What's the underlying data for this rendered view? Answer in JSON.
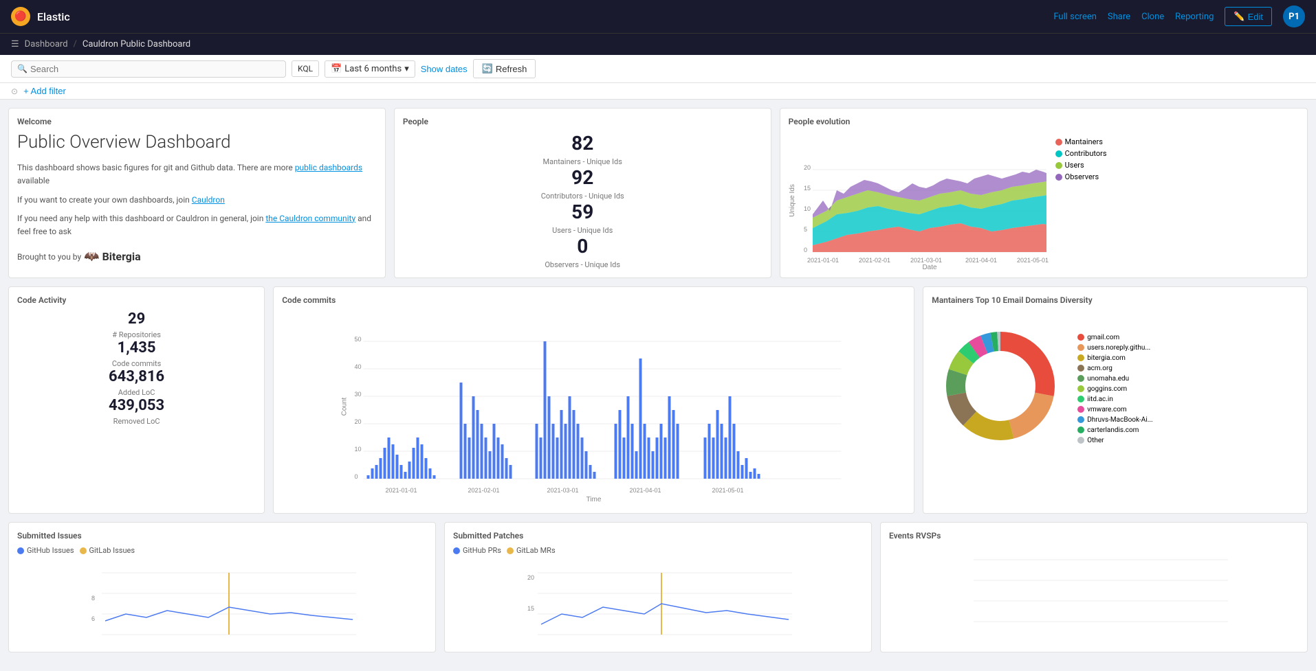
{
  "app": {
    "name": "Elastic",
    "logo_char": "🔴"
  },
  "nav": {
    "breadcrumbs": [
      "Dashboard",
      "Cauldron Public Dashboard"
    ],
    "actions": {
      "full_screen": "Full screen",
      "share": "Share",
      "clone": "Clone",
      "reporting": "Reporting",
      "edit": "Edit"
    }
  },
  "toolbar": {
    "search_placeholder": "Search",
    "kql_label": "KQL",
    "date_range": "Last 6 months",
    "show_dates": "Show dates",
    "refresh": "Refresh",
    "add_filter": "+ Add filter"
  },
  "welcome": {
    "panel_title": "Welcome",
    "heading": "Public Overview Dashboard",
    "description1": "This dashboard shows basic figures for git and Github data. There are more public dashboards available",
    "description2": "If you want to create your own dashboards, join Cauldron",
    "description3": "If you need any help with this dashboard or Cauldron in general, join the Cauldron community and feel free to ask",
    "brought_by": "Brought to you by",
    "bitergia": "Bitergia"
  },
  "people": {
    "panel_title": "People",
    "stats": [
      {
        "value": "82",
        "label": "Mantainers - Unique Ids"
      },
      {
        "value": "92",
        "label": "Contributors - Unique Ids"
      },
      {
        "value": "59",
        "label": "Users - Unique Ids"
      },
      {
        "value": "0",
        "label": "Observers - Unique Ids"
      }
    ]
  },
  "people_evolution": {
    "panel_title": "People evolution",
    "legend": [
      {
        "label": "Mantainers",
        "color": "#e8645a"
      },
      {
        "label": "Contributors",
        "color": "#00c5c5"
      },
      {
        "label": "Users",
        "color": "#98c93c"
      },
      {
        "label": "Observers",
        "color": "#9467bd"
      }
    ],
    "y_axis_label": "Unique Ids",
    "x_axis_label": "Date",
    "x_ticks": [
      "2021-01-01",
      "2021-02-01",
      "2021-03-01",
      "2021-04-01",
      "2021-05-01"
    ],
    "y_ticks": [
      "0",
      "5",
      "10",
      "15",
      "20"
    ]
  },
  "code_activity": {
    "panel_title": "Code Activity",
    "stats": [
      {
        "value": "29",
        "label": "# Repositories"
      },
      {
        "value": "1,435",
        "label": "Code commits"
      },
      {
        "value": "643,816",
        "label": "Added LoC"
      },
      {
        "value": "439,053",
        "label": "Removed LoC"
      }
    ]
  },
  "code_commits": {
    "panel_title": "Code commits",
    "y_axis_label": "Count",
    "x_axis_label": "Time",
    "x_ticks": [
      "2021-01-01",
      "2021-02-01",
      "2021-03-01",
      "2021-04-01",
      "2021-05-01"
    ],
    "y_ticks": [
      "0",
      "10",
      "20",
      "30",
      "40",
      "50"
    ],
    "bar_color": "#4c7af1"
  },
  "email_domains": {
    "panel_title": "Mantainers Top 10 Email Domains Diversity",
    "segments": [
      {
        "label": "gmail.com",
        "color": "#e74c3c",
        "pct": 28
      },
      {
        "label": "users.noreply.githu...",
        "color": "#e8975a",
        "pct": 18
      },
      {
        "label": "bitergia.com",
        "color": "#c0a020",
        "pct": 16
      },
      {
        "label": "acm.org",
        "color": "#8b7355",
        "pct": 10
      },
      {
        "label": "unomaha.edu",
        "color": "#5b9e5b",
        "pct": 8
      },
      {
        "label": "goggins.com",
        "color": "#98c93c",
        "pct": 6
      },
      {
        "label": "iitd.ac.in",
        "color": "#2ecc71",
        "pct": 4
      },
      {
        "label": "vmware.com",
        "color": "#e74c9c",
        "pct": 4
      },
      {
        "label": "Dhruvs-MacBook-Ai...",
        "color": "#3498db",
        "pct": 3
      },
      {
        "label": "carterlandis.com",
        "color": "#27ae60",
        "pct": 2
      },
      {
        "label": "Other",
        "color": "#bdc3c7",
        "pct": 1
      }
    ]
  },
  "submitted_issues": {
    "panel_title": "Submitted Issues",
    "legend": [
      {
        "label": "GitHub Issues",
        "color": "#4c7af1"
      },
      {
        "label": "GitLab Issues",
        "color": "#e8b84b"
      }
    ],
    "y_max": 8
  },
  "submitted_patches": {
    "panel_title": "Submitted Patches",
    "legend": [
      {
        "label": "GitHub PRs",
        "color": "#4c7af1"
      },
      {
        "label": "GitLab MRs",
        "color": "#e8b84b"
      }
    ],
    "y_max": 20
  },
  "events_rsvps": {
    "panel_title": "Events RVSPs"
  },
  "user_avatar": "P1"
}
